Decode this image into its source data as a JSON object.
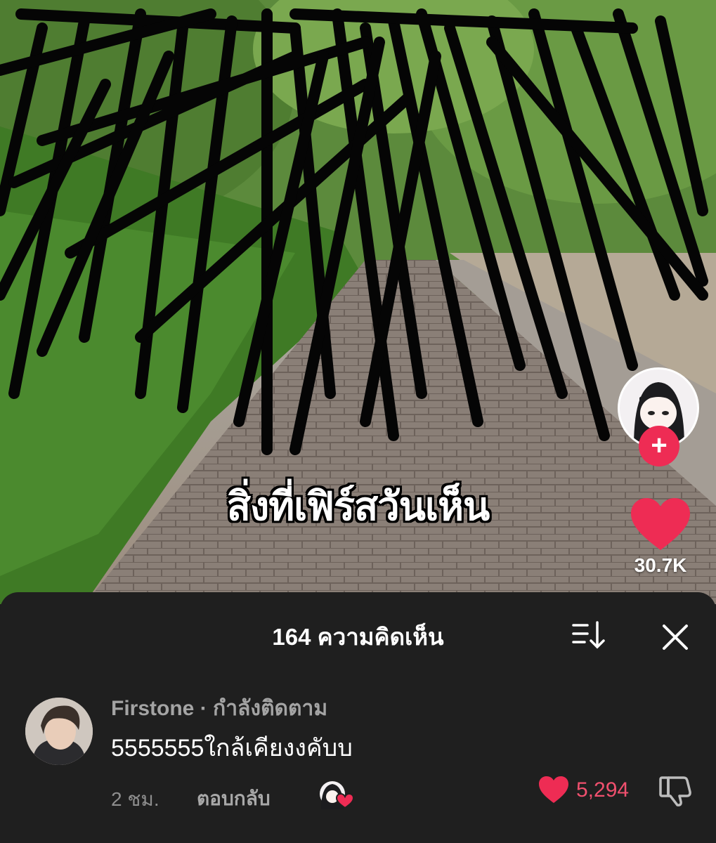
{
  "video": {
    "caption": "สิ่งที่เฟิร์สวันเห็น",
    "like_count": "30.7K",
    "follow_symbol": "+"
  },
  "comments_sheet": {
    "title": "164 ความคิดเห็น",
    "comment": {
      "username": "Firstone",
      "separator": " · ",
      "relation": "กำลังติดตาม",
      "text": "5555555ใกล้เคียงงคับบ",
      "time": "2 ชม.",
      "reply_label": "ตอบกลับ",
      "like_count": "5,294"
    }
  },
  "colors": {
    "accent": "#ee2c54",
    "like_red": "#f0506e",
    "sheet_bg": "#1f1f1f"
  },
  "icons": [
    "sort-icon",
    "close-icon",
    "heart-icon",
    "dislike-icon",
    "plus-icon"
  ]
}
